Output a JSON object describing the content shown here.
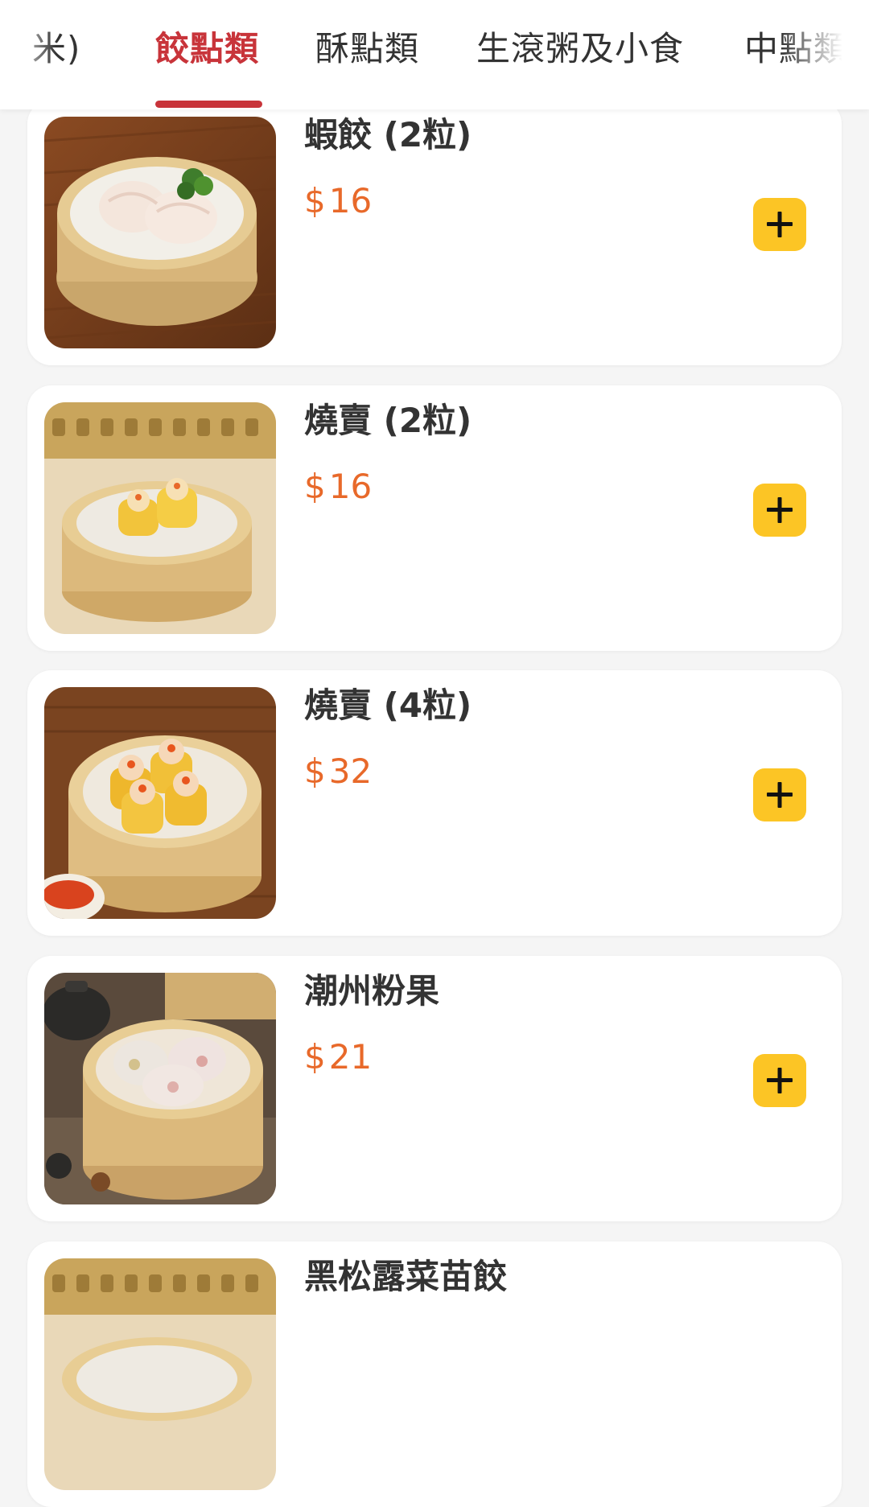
{
  "tabs": [
    {
      "label": "米)",
      "active": false
    },
    {
      "label": "餃點類",
      "active": true
    },
    {
      "label": "酥點類",
      "active": false
    },
    {
      "label": "生滾粥及小食",
      "active": false
    },
    {
      "label": "中點類",
      "active": false
    }
  ],
  "items": [
    {
      "name": "蝦餃 (2粒)",
      "currency": "$",
      "price": "16",
      "image_icon": "har-gow-photo"
    },
    {
      "name": "燒賣 (2粒)",
      "currency": "$",
      "price": "16",
      "image_icon": "siu-mai-photo"
    },
    {
      "name": "燒賣 (4粒)",
      "currency": "$",
      "price": "32",
      "image_icon": "siu-mai-photo"
    },
    {
      "name": "潮州粉果",
      "currency": "$",
      "price": "21",
      "image_icon": "chiu-chow-dumpling-photo"
    },
    {
      "name": "黑松露菜苗餃",
      "currency": "$",
      "price": "",
      "image_icon": "truffle-dumpling-photo"
    }
  ],
  "colors": {
    "accent": "#c8343a",
    "price": "#e8692a",
    "add_button": "#fcc525",
    "background": "#f5f5f5"
  }
}
